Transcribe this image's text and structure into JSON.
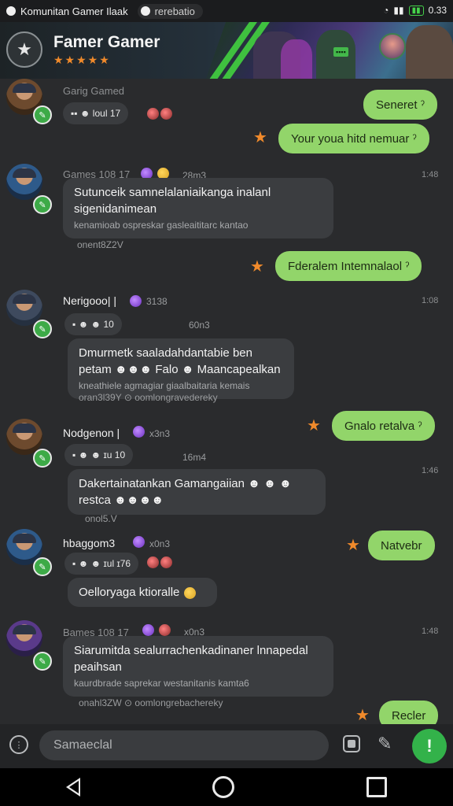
{
  "status": {
    "notification_app": "Komunitan Gamer Ilaak",
    "pill_text": "rerebatio",
    "time": "0.33"
  },
  "header": {
    "title": "Famer Gamer",
    "stars": "★★★★★",
    "banner_tag": "▪▪▪▪"
  },
  "messages": [
    {
      "name": "Garig Gamed"
    },
    {
      "react": "▪▪ ☻ loul 17"
    },
    {
      "out": "Seneret ˀ"
    },
    {
      "out": "Your youa hitd nemuar ˀ"
    },
    {
      "name": "Games 108 17",
      "meta": "28m3",
      "time": "1:48",
      "text": "Sutunceik samnelalaniaikanga inalanl sigenidanimean",
      "sub": "kenamioab  ospreskar gasleaititarc kantao",
      "below": "onent8Z2V"
    },
    {
      "out": "Fderalem Intemnalaol ˀ"
    },
    {
      "name": "Nerigooo| |",
      "meta": "3138",
      "time": "1:08",
      "react": "▪ ☻ ☻ 10",
      "react_meta": "60n3",
      "text": "Dmurmetk saaladahdantabie ben petam ☻☻☻ Falo ☻ Maancapealkan",
      "sub": "kneathiele  agmagiar giaalbaitaria kemais",
      "below": "oran3l39Y  ⊙ oomlongravedereky"
    },
    {
      "out": "Gnalo retalva ˀ"
    },
    {
      "name": "Nodgenon |",
      "meta": "x3n3",
      "time": "1:46",
      "react": "▪ ☻ ☻ ɪu 10",
      "react_meta": "16m4",
      "text": "Dakertainatankan Gamangaiian ☻ ☻ ☻ restca ☻☻☻☻",
      "below": "onol5.V"
    },
    {
      "out": "Natvebr"
    },
    {
      "name": "hbaggom3",
      "meta": "x0n3",
      "react": "▪ ☻ ☻ ɪul ɪ76",
      "text": "Oelloryaga ktioralle"
    },
    {
      "name": "Bames 108 17",
      "meta": "x0n3",
      "time": "1:48",
      "text": "Siarumitda sealurrachenkadinaner lnnapedal peaihsan",
      "sub": "kaurdbrade  saprekar westanitanis kamta6",
      "below": "onahl3ZW  ⊙ oomlongrebachereky"
    },
    {
      "out": "Recler"
    }
  ],
  "composer": {
    "placeholder": "Samaeclal",
    "send_label": "!"
  }
}
